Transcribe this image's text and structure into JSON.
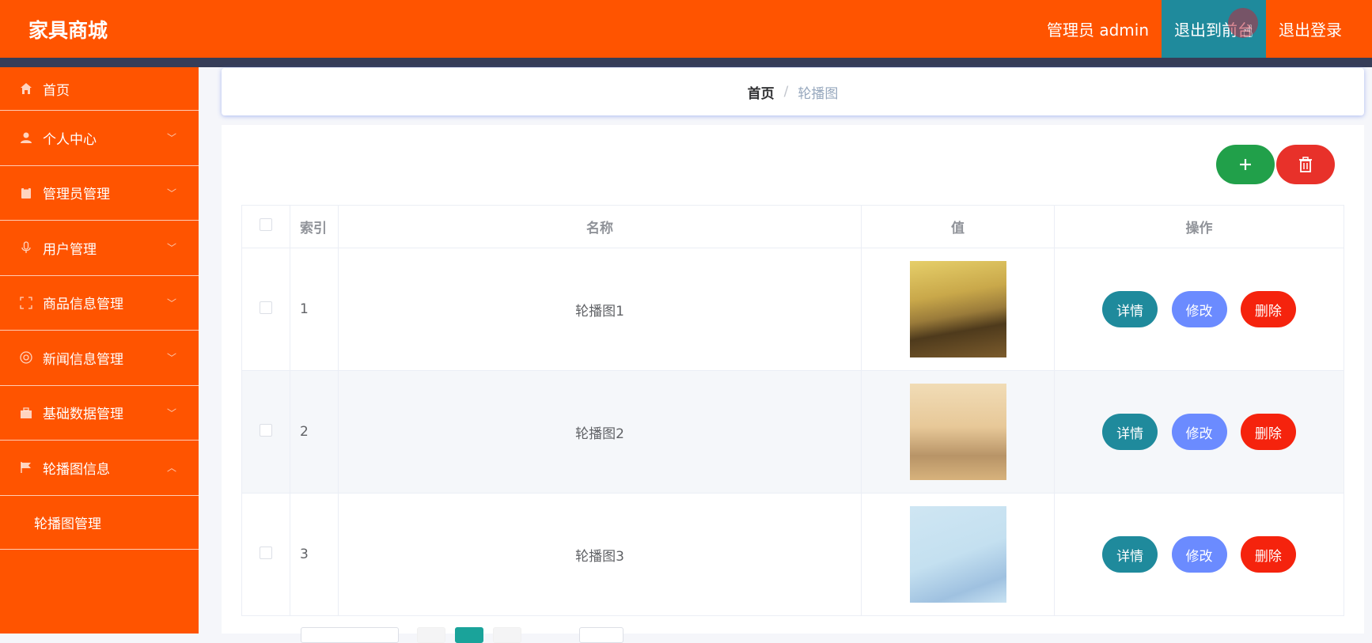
{
  "header": {
    "logo": "家具商城",
    "admin_label": "管理员 admin",
    "front_button": "退出到前台",
    "logout_button": "退出登录"
  },
  "sidebar": {
    "items": [
      {
        "label": "首页",
        "icon": "home-icon"
      },
      {
        "label": "个人中心",
        "icon": "user-icon"
      },
      {
        "label": "管理员管理",
        "icon": "clipboard-icon"
      },
      {
        "label": "用户管理",
        "icon": "microphone-icon"
      },
      {
        "label": "商品信息管理",
        "icon": "fullscreen-icon"
      },
      {
        "label": "新闻信息管理",
        "icon": "at-icon"
      },
      {
        "label": "基础数据管理",
        "icon": "briefcase-icon"
      },
      {
        "label": "轮播图信息",
        "icon": "flag-icon"
      }
    ],
    "sub_item": "轮播图管理"
  },
  "breadcrumb": {
    "home": "首页",
    "separator": "/",
    "current": "轮播图"
  },
  "table": {
    "headers": {
      "index": "索引",
      "name": "名称",
      "value": "值",
      "actions": "操作"
    },
    "rows": [
      {
        "index": "1",
        "name": "轮播图1"
      },
      {
        "index": "2",
        "name": "轮播图2"
      },
      {
        "index": "3",
        "name": "轮播图3"
      }
    ],
    "actions": {
      "detail": "详情",
      "edit": "修改",
      "remove": "删除"
    }
  },
  "colors": {
    "primary": "#ff5400",
    "teal": "#1f8a9c",
    "green": "#21a04a",
    "red": "#e8312a",
    "blue": "#6b8bff"
  }
}
